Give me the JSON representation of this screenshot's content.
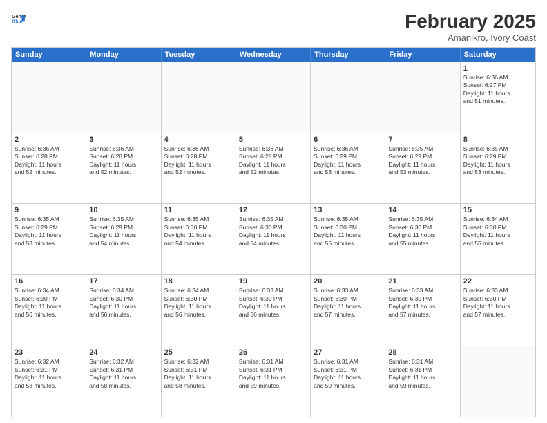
{
  "header": {
    "logo_general": "General",
    "logo_blue": "Blue",
    "month_title": "February 2025",
    "location": "Amanikro, Ivory Coast"
  },
  "weekdays": [
    "Sunday",
    "Monday",
    "Tuesday",
    "Wednesday",
    "Thursday",
    "Friday",
    "Saturday"
  ],
  "rows": [
    [
      {
        "day": "",
        "info": ""
      },
      {
        "day": "",
        "info": ""
      },
      {
        "day": "",
        "info": ""
      },
      {
        "day": "",
        "info": ""
      },
      {
        "day": "",
        "info": ""
      },
      {
        "day": "",
        "info": ""
      },
      {
        "day": "1",
        "info": "Sunrise: 6:36 AM\nSunset: 6:27 PM\nDaylight: 11 hours\nand 51 minutes."
      }
    ],
    [
      {
        "day": "2",
        "info": "Sunrise: 6:36 AM\nSunset: 6:28 PM\nDaylight: 11 hours\nand 52 minutes."
      },
      {
        "day": "3",
        "info": "Sunrise: 6:36 AM\nSunset: 6:28 PM\nDaylight: 11 hours\nand 52 minutes."
      },
      {
        "day": "4",
        "info": "Sunrise: 6:36 AM\nSunset: 6:28 PM\nDaylight: 11 hours\nand 52 minutes."
      },
      {
        "day": "5",
        "info": "Sunrise: 6:36 AM\nSunset: 6:28 PM\nDaylight: 11 hours\nand 52 minutes."
      },
      {
        "day": "6",
        "info": "Sunrise: 6:36 AM\nSunset: 6:29 PM\nDaylight: 11 hours\nand 53 minutes."
      },
      {
        "day": "7",
        "info": "Sunrise: 6:35 AM\nSunset: 6:29 PM\nDaylight: 11 hours\nand 53 minutes."
      },
      {
        "day": "8",
        "info": "Sunrise: 6:35 AM\nSunset: 6:29 PM\nDaylight: 11 hours\nand 53 minutes."
      }
    ],
    [
      {
        "day": "9",
        "info": "Sunrise: 6:35 AM\nSunset: 6:29 PM\nDaylight: 11 hours\nand 53 minutes."
      },
      {
        "day": "10",
        "info": "Sunrise: 6:35 AM\nSunset: 6:29 PM\nDaylight: 11 hours\nand 54 minutes."
      },
      {
        "day": "11",
        "info": "Sunrise: 6:35 AM\nSunset: 6:30 PM\nDaylight: 11 hours\nand 54 minutes."
      },
      {
        "day": "12",
        "info": "Sunrise: 6:35 AM\nSunset: 6:30 PM\nDaylight: 11 hours\nand 54 minutes."
      },
      {
        "day": "13",
        "info": "Sunrise: 6:35 AM\nSunset: 6:30 PM\nDaylight: 11 hours\nand 55 minutes."
      },
      {
        "day": "14",
        "info": "Sunrise: 6:35 AM\nSunset: 6:30 PM\nDaylight: 11 hours\nand 55 minutes."
      },
      {
        "day": "15",
        "info": "Sunrise: 6:34 AM\nSunset: 6:30 PM\nDaylight: 11 hours\nand 55 minutes."
      }
    ],
    [
      {
        "day": "16",
        "info": "Sunrise: 6:34 AM\nSunset: 6:30 PM\nDaylight: 11 hours\nand 56 minutes."
      },
      {
        "day": "17",
        "info": "Sunrise: 6:34 AM\nSunset: 6:30 PM\nDaylight: 11 hours\nand 56 minutes."
      },
      {
        "day": "18",
        "info": "Sunrise: 6:34 AM\nSunset: 6:30 PM\nDaylight: 11 hours\nand 56 minutes."
      },
      {
        "day": "19",
        "info": "Sunrise: 6:33 AM\nSunset: 6:30 PM\nDaylight: 11 hours\nand 56 minutes."
      },
      {
        "day": "20",
        "info": "Sunrise: 6:33 AM\nSunset: 6:30 PM\nDaylight: 11 hours\nand 57 minutes."
      },
      {
        "day": "21",
        "info": "Sunrise: 6:33 AM\nSunset: 6:30 PM\nDaylight: 11 hours\nand 57 minutes."
      },
      {
        "day": "22",
        "info": "Sunrise: 6:33 AM\nSunset: 6:30 PM\nDaylight: 11 hours\nand 57 minutes."
      }
    ],
    [
      {
        "day": "23",
        "info": "Sunrise: 6:32 AM\nSunset: 6:31 PM\nDaylight: 11 hours\nand 58 minutes."
      },
      {
        "day": "24",
        "info": "Sunrise: 6:32 AM\nSunset: 6:31 PM\nDaylight: 11 hours\nand 58 minutes."
      },
      {
        "day": "25",
        "info": "Sunrise: 6:32 AM\nSunset: 6:31 PM\nDaylight: 11 hours\nand 58 minutes."
      },
      {
        "day": "26",
        "info": "Sunrise: 6:31 AM\nSunset: 6:31 PM\nDaylight: 11 hours\nand 59 minutes."
      },
      {
        "day": "27",
        "info": "Sunrise: 6:31 AM\nSunset: 6:31 PM\nDaylight: 11 hours\nand 59 minutes."
      },
      {
        "day": "28",
        "info": "Sunrise: 6:31 AM\nSunset: 6:31 PM\nDaylight: 11 hours\nand 59 minutes."
      },
      {
        "day": "",
        "info": ""
      }
    ]
  ]
}
